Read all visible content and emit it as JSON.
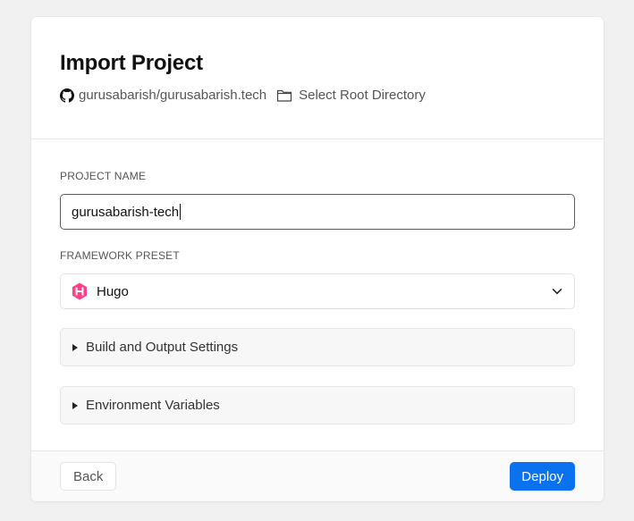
{
  "dialog": {
    "title": "Import Project",
    "repo": {
      "icon": "github-icon",
      "name": "gurusabarish/gurusabarish.tech"
    },
    "root": {
      "icon": "folder-icon",
      "label": "Select Root Directory"
    }
  },
  "form": {
    "project_name": {
      "label": "PROJECT NAME",
      "value": "gurusabarish-tech"
    },
    "framework": {
      "label": "FRAMEWORK PRESET",
      "icon": "hugo-icon",
      "value": "Hugo",
      "icon_color": "#ff4088"
    },
    "sections": [
      {
        "label": "Build and Output Settings",
        "icon": "triangle-right-icon"
      },
      {
        "label": "Environment Variables",
        "icon": "triangle-right-icon"
      }
    ]
  },
  "footer": {
    "back_label": "Back",
    "deploy_label": "Deploy",
    "accent": "#0a72ef"
  }
}
